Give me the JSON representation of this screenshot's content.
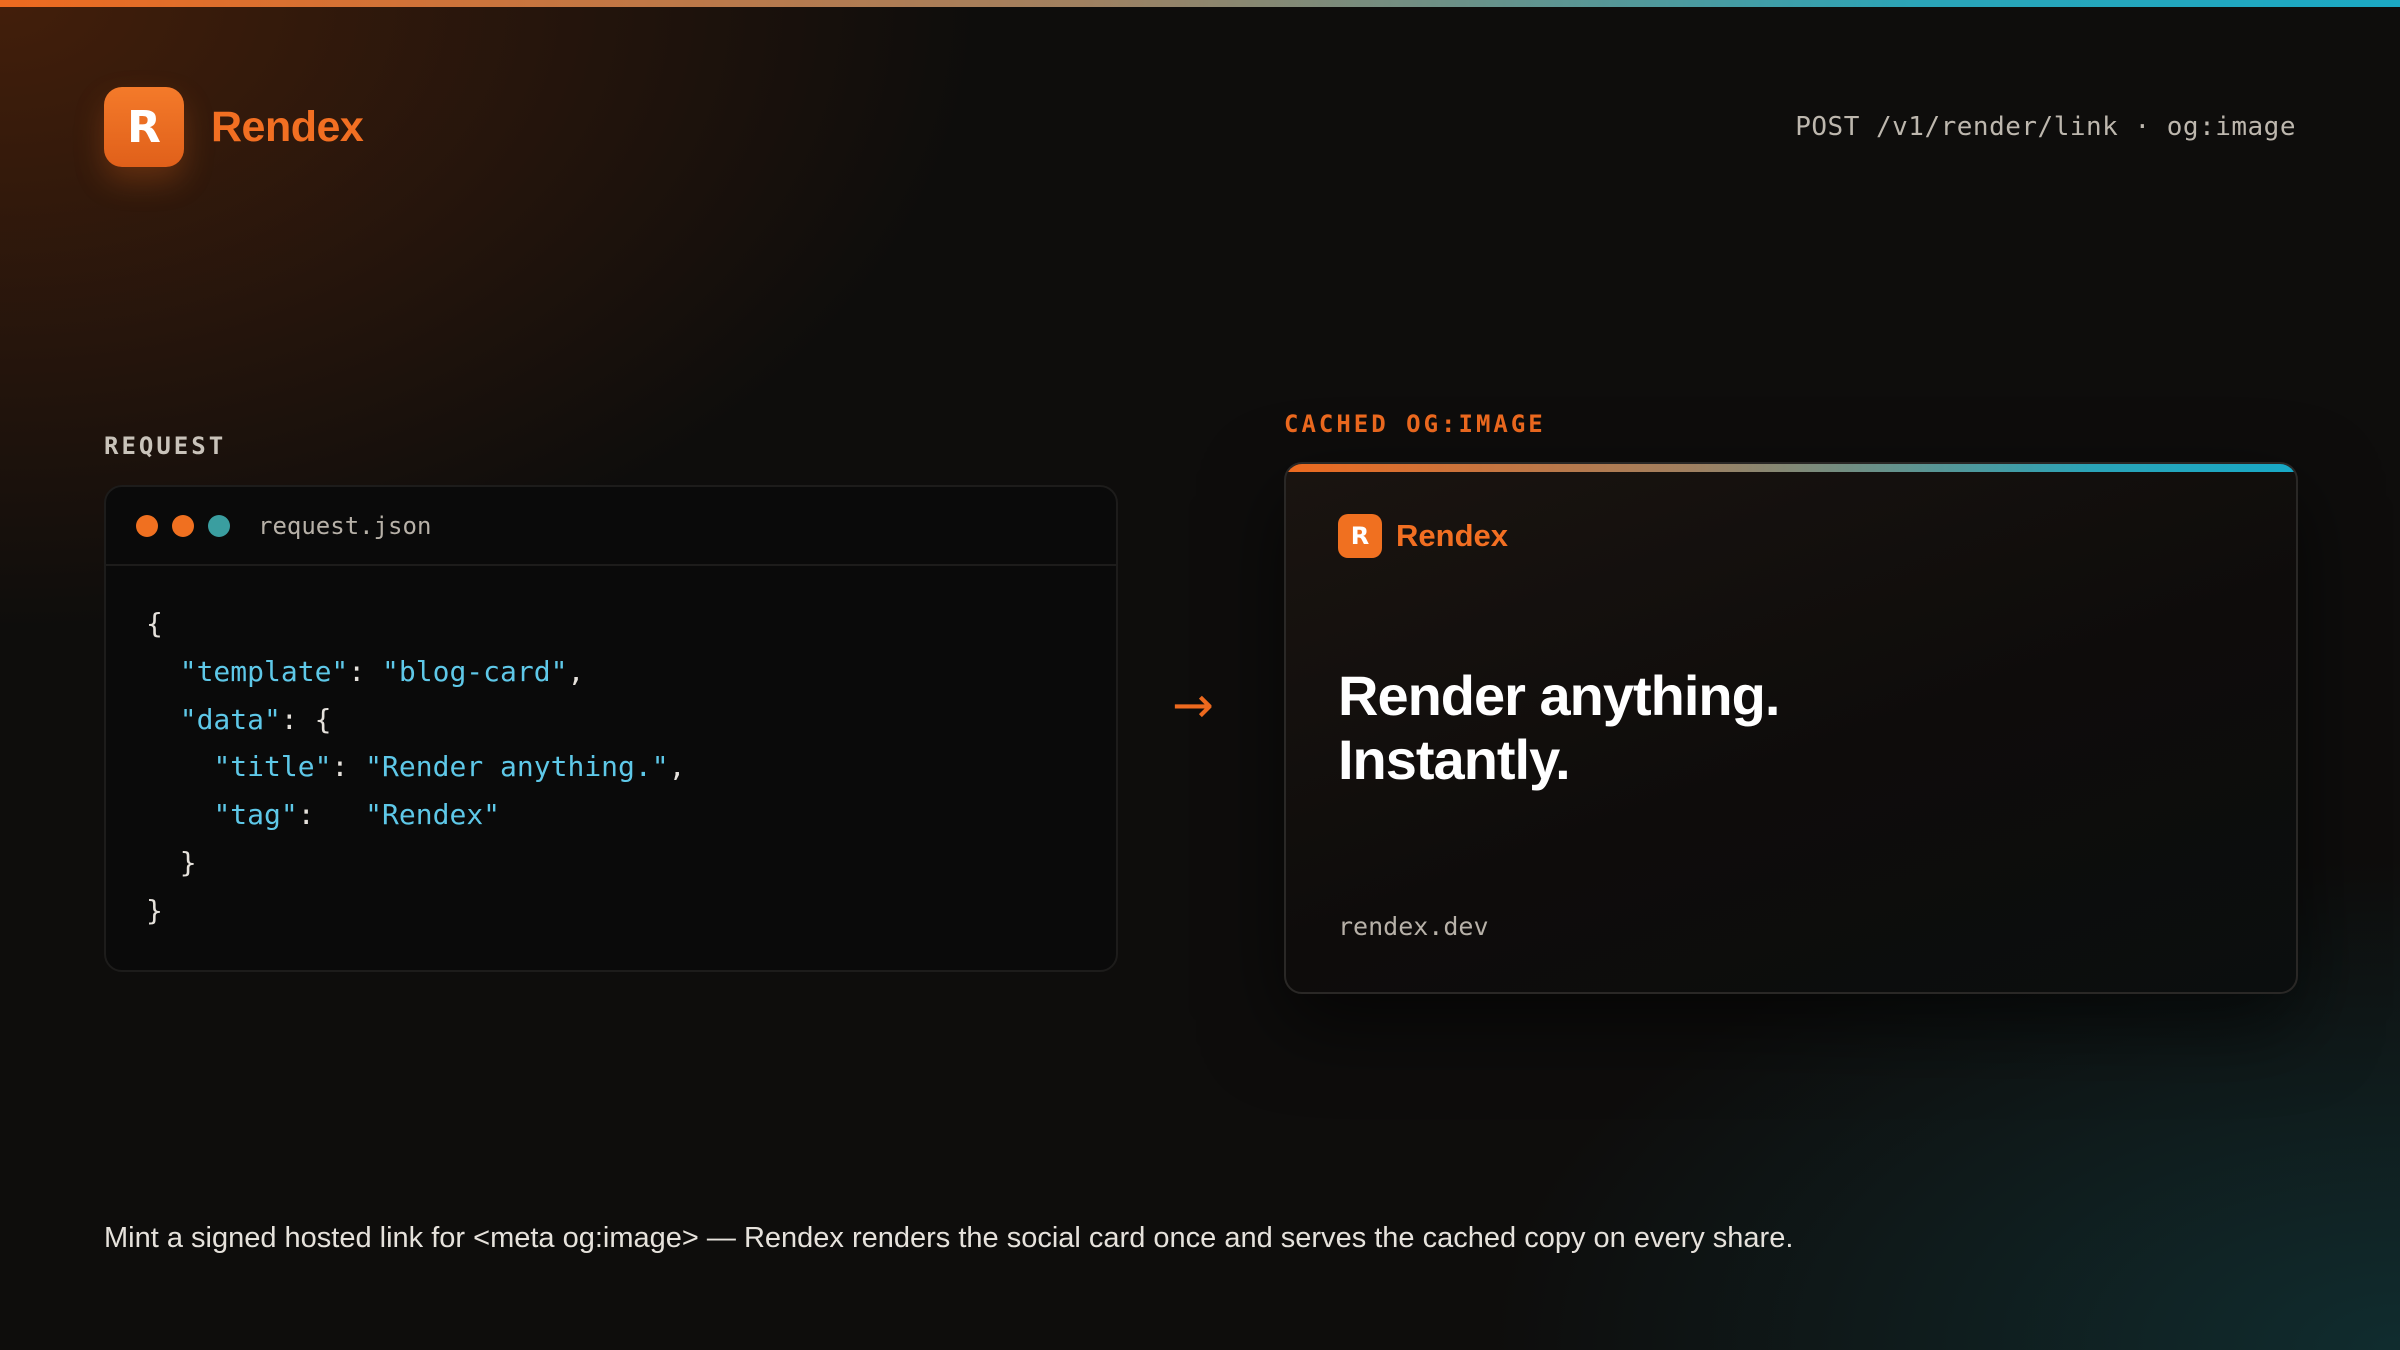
{
  "brand": {
    "name": "Rendex",
    "logo_letter": "R",
    "accent_color": "#ee6a1f",
    "secondary_color": "#2aa4b8"
  },
  "header": {
    "endpoint": "POST /v1/render/link · og:image"
  },
  "request": {
    "section_label": "REQUEST",
    "filename": "request.json",
    "code_lines": [
      "{",
      "  \"template\": \"blog-card\",",
      "  \"data\": {",
      "    \"title\": \"Render anything.\",",
      "    \"tag\":   \"Rendex\"",
      "  }",
      "}"
    ],
    "window_dots": [
      "orange",
      "orange",
      "teal"
    ]
  },
  "result": {
    "section_label": "CACHED OG:IMAGE",
    "arrow_icon": "→",
    "card": {
      "brand_name": "Rendex",
      "logo_letter": "R",
      "headline_line1": "Render anything.",
      "headline_line2": "Instantly.",
      "domain": "rendex.dev"
    }
  },
  "caption": "Mint a signed hosted link for <meta og:image> — Rendex renders the social card once and serves the cached copy on every share."
}
